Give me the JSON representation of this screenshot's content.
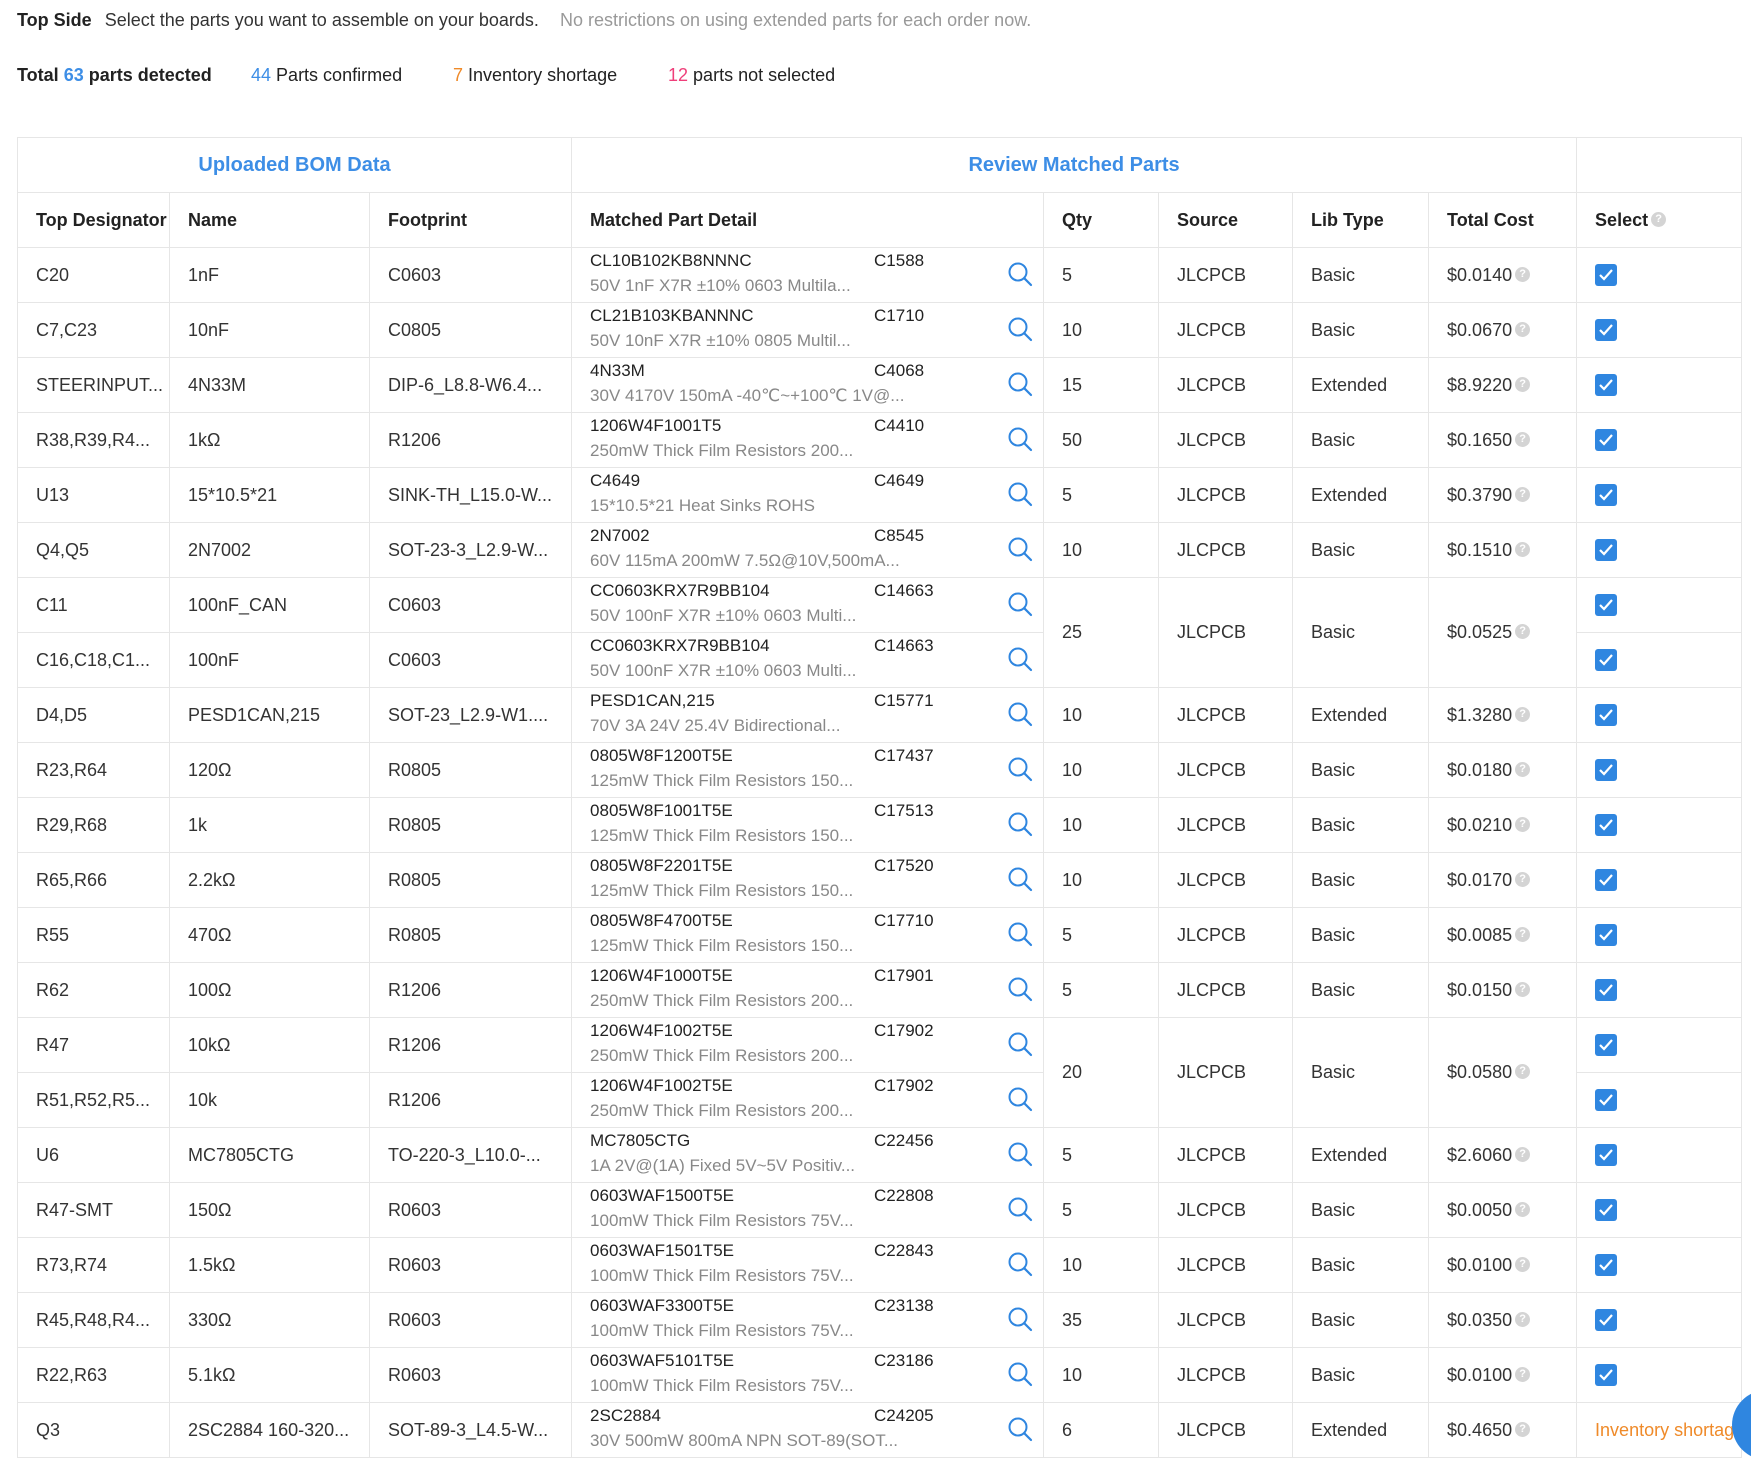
{
  "header": {
    "side": "Top Side",
    "instruction": "Select the parts you want to assemble on your boards.",
    "note": "No restrictions on using extended parts for each order now."
  },
  "stats": {
    "total_prefix": "Total",
    "total_count": "63",
    "total_suffix": "parts detected",
    "confirmed_count": "44",
    "confirmed_label": "Parts confirmed",
    "shortage_count": "7",
    "shortage_label": "Inventory shortage",
    "not_selected_count": "12",
    "not_selected_label": "parts not selected"
  },
  "sections": {
    "uploaded": "Uploaded BOM Data",
    "review": "Review Matched Parts"
  },
  "columns": {
    "designator": "Top Designator",
    "name": "Name",
    "footprint": "Footprint",
    "detail": "Matched Part Detail",
    "qty": "Qty",
    "source": "Source",
    "lib_type": "Lib Type",
    "total_cost": "Total Cost",
    "select": "Select"
  },
  "icons": {
    "search": "search-icon",
    "help": "help-icon",
    "check": "checkbox-checked-icon"
  },
  "colors": {
    "accent": "#3d8ee6",
    "shortage": "#ef8a29",
    "not_selected": "#ef3f7a",
    "checkbox": "#2f86e0"
  },
  "rows": [
    {
      "designator": "C20",
      "name": "1nF",
      "footprint": "C0603",
      "mpn": "CL10B102KB8NNNC",
      "lcsc": "C1588",
      "desc": "50V 1nF X7R ±10% 0603 Multila...",
      "qty": "5",
      "source": "JLCPCB",
      "lib_type": "Basic",
      "cost": "$0.0140",
      "group": 1,
      "selected": true
    },
    {
      "designator": "C7,C23",
      "name": "10nF",
      "footprint": "C0805",
      "mpn": "CL21B103KBANNNC",
      "lcsc": "C1710",
      "desc": "50V 10nF X7R ±10% 0805 Multil...",
      "qty": "10",
      "source": "JLCPCB",
      "lib_type": "Basic",
      "cost": "$0.0670",
      "group": 1,
      "selected": true
    },
    {
      "designator": "STEERINPUT...",
      "name": "4N33M",
      "footprint": "DIP-6_L8.8-W6.4...",
      "mpn": "4N33M",
      "lcsc": "C4068",
      "desc": "30V 4170V 150mA -40℃~+100℃ 1V@...",
      "qty": "15",
      "source": "JLCPCB",
      "lib_type": "Extended",
      "cost": "$8.9220",
      "group": 1,
      "selected": true
    },
    {
      "designator": "R38,R39,R4...",
      "name": "1kΩ",
      "footprint": "R1206",
      "mpn": "1206W4F1001T5",
      "lcsc": "C4410",
      "desc": "250mW Thick Film Resistors 200...",
      "qty": "50",
      "source": "JLCPCB",
      "lib_type": "Basic",
      "cost": "$0.1650",
      "group": 1,
      "selected": true
    },
    {
      "designator": "U13",
      "name": "15*10.5*21",
      "footprint": "SINK-TH_L15.0-W...",
      "mpn": "C4649",
      "lcsc": "C4649",
      "desc": "15*10.5*21 Heat Sinks ROHS",
      "qty": "5",
      "source": "JLCPCB",
      "lib_type": "Extended",
      "cost": "$0.3790",
      "group": 1,
      "selected": true
    },
    {
      "designator": "Q4,Q5",
      "name": "2N7002",
      "footprint": "SOT-23-3_L2.9-W...",
      "mpn": "2N7002",
      "lcsc": "C8545",
      "desc": "60V 115mA 200mW 7.5Ω@10V,500mA...",
      "qty": "10",
      "source": "JLCPCB",
      "lib_type": "Basic",
      "cost": "$0.1510",
      "group": 1,
      "selected": true
    },
    {
      "designator": "C11",
      "name": "100nF_CAN",
      "footprint": "C0603",
      "mpn": "CC0603KRX7R9BB104",
      "lcsc": "C14663",
      "desc": "50V 100nF X7R ±10% 0603 Multi...",
      "qty": "25",
      "source": "JLCPCB",
      "lib_type": "Basic",
      "cost": "$0.0525",
      "group": 2,
      "selected": true
    },
    {
      "designator": "C16,C18,C1...",
      "name": "100nF",
      "footprint": "C0603",
      "mpn": "CC0603KRX7R9BB104",
      "lcsc": "C14663",
      "desc": "50V 100nF X7R ±10% 0603 Multi...",
      "group": 0,
      "selected": true
    },
    {
      "designator": "D4,D5",
      "name": "PESD1CAN,215",
      "footprint": "SOT-23_L2.9-W1....",
      "mpn": "PESD1CAN,215",
      "lcsc": "C15771",
      "desc": "70V 3A 24V 25.4V Bidirectional...",
      "qty": "10",
      "source": "JLCPCB",
      "lib_type": "Extended",
      "cost": "$1.3280",
      "group": 1,
      "selected": true
    },
    {
      "designator": "R23,R64",
      "name": "120Ω",
      "footprint": "R0805",
      "mpn": "0805W8F1200T5E",
      "lcsc": "C17437",
      "desc": "125mW Thick Film Resistors 150...",
      "qty": "10",
      "source": "JLCPCB",
      "lib_type": "Basic",
      "cost": "$0.0180",
      "group": 1,
      "selected": true
    },
    {
      "designator": "R29,R68",
      "name": "1k",
      "footprint": "R0805",
      "mpn": "0805W8F1001T5E",
      "lcsc": "C17513",
      "desc": "125mW Thick Film Resistors 150...",
      "qty": "10",
      "source": "JLCPCB",
      "lib_type": "Basic",
      "cost": "$0.0210",
      "group": 1,
      "selected": true
    },
    {
      "designator": "R65,R66",
      "name": "2.2kΩ",
      "footprint": "R0805",
      "mpn": "0805W8F2201T5E",
      "lcsc": "C17520",
      "desc": "125mW Thick Film Resistors 150...",
      "qty": "10",
      "source": "JLCPCB",
      "lib_type": "Basic",
      "cost": "$0.0170",
      "group": 1,
      "selected": true
    },
    {
      "designator": "R55",
      "name": "470Ω",
      "footprint": "R0805",
      "mpn": "0805W8F4700T5E",
      "lcsc": "C17710",
      "desc": "125mW Thick Film Resistors 150...",
      "qty": "5",
      "source": "JLCPCB",
      "lib_type": "Basic",
      "cost": "$0.0085",
      "group": 1,
      "selected": true
    },
    {
      "designator": "R62",
      "name": "100Ω",
      "footprint": "R1206",
      "mpn": "1206W4F1000T5E",
      "lcsc": "C17901",
      "desc": "250mW Thick Film Resistors 200...",
      "qty": "5",
      "source": "JLCPCB",
      "lib_type": "Basic",
      "cost": "$0.0150",
      "group": 1,
      "selected": true
    },
    {
      "designator": "R47",
      "name": "10kΩ",
      "footprint": "R1206",
      "mpn": "1206W4F1002T5E",
      "lcsc": "C17902",
      "desc": "250mW Thick Film Resistors 200...",
      "qty": "20",
      "source": "JLCPCB",
      "lib_type": "Basic",
      "cost": "$0.0580",
      "group": 2,
      "selected": true
    },
    {
      "designator": "R51,R52,R5...",
      "name": "10k",
      "footprint": "R1206",
      "mpn": "1206W4F1002T5E",
      "lcsc": "C17902",
      "desc": "250mW Thick Film Resistors 200...",
      "group": 0,
      "selected": true
    },
    {
      "designator": "U6",
      "name": "MC7805CTG",
      "footprint": "TO-220-3_L10.0-...",
      "mpn": "MC7805CTG",
      "lcsc": "C22456",
      "desc": "1A 2V@(1A) Fixed 5V~5V Positiv...",
      "qty": "5",
      "source": "JLCPCB",
      "lib_type": "Extended",
      "cost": "$2.6060",
      "group": 1,
      "selected": true
    },
    {
      "designator": "R47-SMT",
      "name": "150Ω",
      "footprint": "R0603",
      "mpn": "0603WAF1500T5E",
      "lcsc": "C22808",
      "desc": "100mW Thick Film Resistors 75V...",
      "qty": "5",
      "source": "JLCPCB",
      "lib_type": "Basic",
      "cost": "$0.0050",
      "group": 1,
      "selected": true
    },
    {
      "designator": "R73,R74",
      "name": "1.5kΩ",
      "footprint": "R0603",
      "mpn": "0603WAF1501T5E",
      "lcsc": "C22843",
      "desc": "100mW Thick Film Resistors 75V...",
      "qty": "10",
      "source": "JLCPCB",
      "lib_type": "Basic",
      "cost": "$0.0100",
      "group": 1,
      "selected": true
    },
    {
      "designator": "R45,R48,R4...",
      "name": "330Ω",
      "footprint": "R0603",
      "mpn": "0603WAF3300T5E",
      "lcsc": "C23138",
      "desc": "100mW Thick Film Resistors 75V...",
      "qty": "35",
      "source": "JLCPCB",
      "lib_type": "Basic",
      "cost": "$0.0350",
      "group": 1,
      "selected": true
    },
    {
      "designator": "R22,R63",
      "name": "5.1kΩ",
      "footprint": "R0603",
      "mpn": "0603WAF5101T5E",
      "lcsc": "C23186",
      "desc": "100mW Thick Film Resistors 75V...",
      "qty": "10",
      "source": "JLCPCB",
      "lib_type": "Basic",
      "cost": "$0.0100",
      "group": 1,
      "selected": true
    },
    {
      "designator": "Q3",
      "name": "2SC2884 160-320...",
      "footprint": "SOT-89-3_L4.5-W...",
      "mpn": "2SC2884",
      "lcsc": "C24205",
      "desc": "30V 500mW 800mA NPN SOT-89(SOT...",
      "qty": "6",
      "source": "JLCPCB",
      "lib_type": "Extended",
      "cost": "$0.4650",
      "group": 1,
      "selected": false,
      "status": "Inventory shortage"
    }
  ]
}
